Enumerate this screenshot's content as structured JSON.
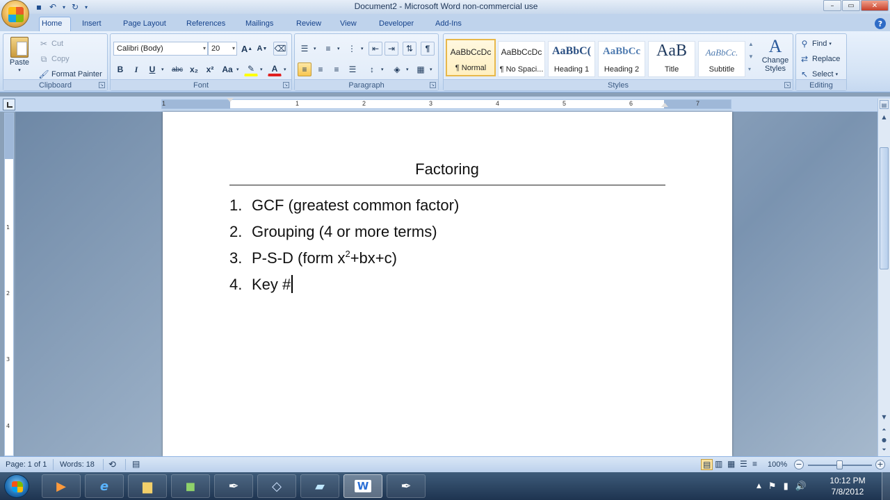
{
  "window": {
    "title": "Document2 - Microsoft Word non-commercial use"
  },
  "ribbon_tabs": [
    "Home",
    "Insert",
    "Page Layout",
    "References",
    "Mailings",
    "Review",
    "View",
    "Developer",
    "Add-Ins"
  ],
  "clipboard": {
    "paste": "Paste",
    "cut": "Cut",
    "copy": "Copy",
    "format_painter": "Format Painter",
    "label": "Clipboard"
  },
  "font": {
    "family": "Calibri (Body)",
    "size": "20",
    "label": "Font",
    "bold": "B",
    "italic": "I",
    "underline": "U",
    "strike": "abc",
    "subscript": "x₂",
    "superscript": "x²",
    "change_case": "Aa",
    "grow": "A",
    "shrink": "A",
    "font_color_letter": "A"
  },
  "paragraph": {
    "label": "Paragraph"
  },
  "styles": {
    "label": "Styles",
    "tiles": [
      {
        "sample": "AaBbCcDc",
        "name": "¶ Normal"
      },
      {
        "sample": "AaBbCcDc",
        "name": "¶ No Spaci..."
      },
      {
        "sample": "AaBbC(",
        "name": "Heading 1"
      },
      {
        "sample": "AaBbCc",
        "name": "Heading 2"
      },
      {
        "sample": "AaB",
        "name": "Title"
      },
      {
        "sample": "AaBbCc.",
        "name": "Subtitle"
      }
    ],
    "change_styles": "Change Styles"
  },
  "editing": {
    "label": "Editing",
    "find": "Find",
    "replace": "Replace",
    "select": "Select"
  },
  "ruler": {
    "numbers": [
      "1",
      "1",
      "2",
      "3",
      "4",
      "5",
      "6",
      "7"
    ],
    "vnumbers": [
      "1",
      "2",
      "3",
      "4"
    ]
  },
  "document": {
    "heading": "Factoring",
    "items": [
      {
        "num": "1.",
        "text": "GCF (greatest common factor)"
      },
      {
        "num": "2.",
        "text": "Grouping (4 or more terms)"
      },
      {
        "num": "3.",
        "text_before": "P-S-D (form x",
        "sup": "2",
        "text_after": "+bx+c)"
      },
      {
        "num": "4.",
        "text": "Key #"
      }
    ]
  },
  "status": {
    "page": "Page: 1 of 1",
    "words": "Words: 18",
    "zoom": "100%"
  },
  "clock": {
    "time": "10:12 PM",
    "date": "7/8/2012"
  }
}
